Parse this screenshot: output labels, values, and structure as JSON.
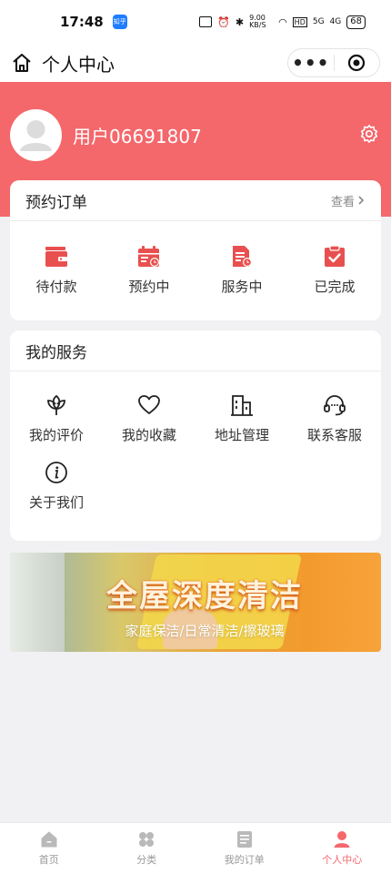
{
  "status_bar": {
    "time": "17:48",
    "app_badge": "知乎",
    "speed": "9.00 KB/S",
    "hd": "HD",
    "signal1": "5G",
    "signal2": "4G",
    "battery": "68"
  },
  "nav": {
    "title": "个人中心",
    "more": "•••"
  },
  "user": {
    "name": "用户06691807"
  },
  "orders": {
    "title": "预约订单",
    "more": "查看",
    "items": [
      {
        "label": "待付款",
        "icon": "wallet-icon"
      },
      {
        "label": "预约中",
        "icon": "calendar-clock-icon"
      },
      {
        "label": "服务中",
        "icon": "document-clock-icon"
      },
      {
        "label": "已完成",
        "icon": "clipboard-check-icon"
      }
    ]
  },
  "services": {
    "title": "我的服务",
    "items": [
      {
        "label": "我的评价",
        "icon": "lotus-icon"
      },
      {
        "label": "我的收藏",
        "icon": "heart-icon"
      },
      {
        "label": "地址管理",
        "icon": "building-icon"
      },
      {
        "label": "联系客服",
        "icon": "headset-icon"
      },
      {
        "label": "关于我们",
        "icon": "info-icon"
      }
    ]
  },
  "banner": {
    "title": "全屋深度清洁",
    "subtitle": "家庭保洁/日常清洁/擦玻璃"
  },
  "tabbar": {
    "items": [
      {
        "label": "首页",
        "icon": "home-icon"
      },
      {
        "label": "分类",
        "icon": "category-icon"
      },
      {
        "label": "我的订单",
        "icon": "orders-icon"
      },
      {
        "label": "个人中心",
        "icon": "user-icon"
      }
    ],
    "active_index": 3
  },
  "colors": {
    "accent": "#f4676b",
    "icon_red": "#e8504f"
  }
}
